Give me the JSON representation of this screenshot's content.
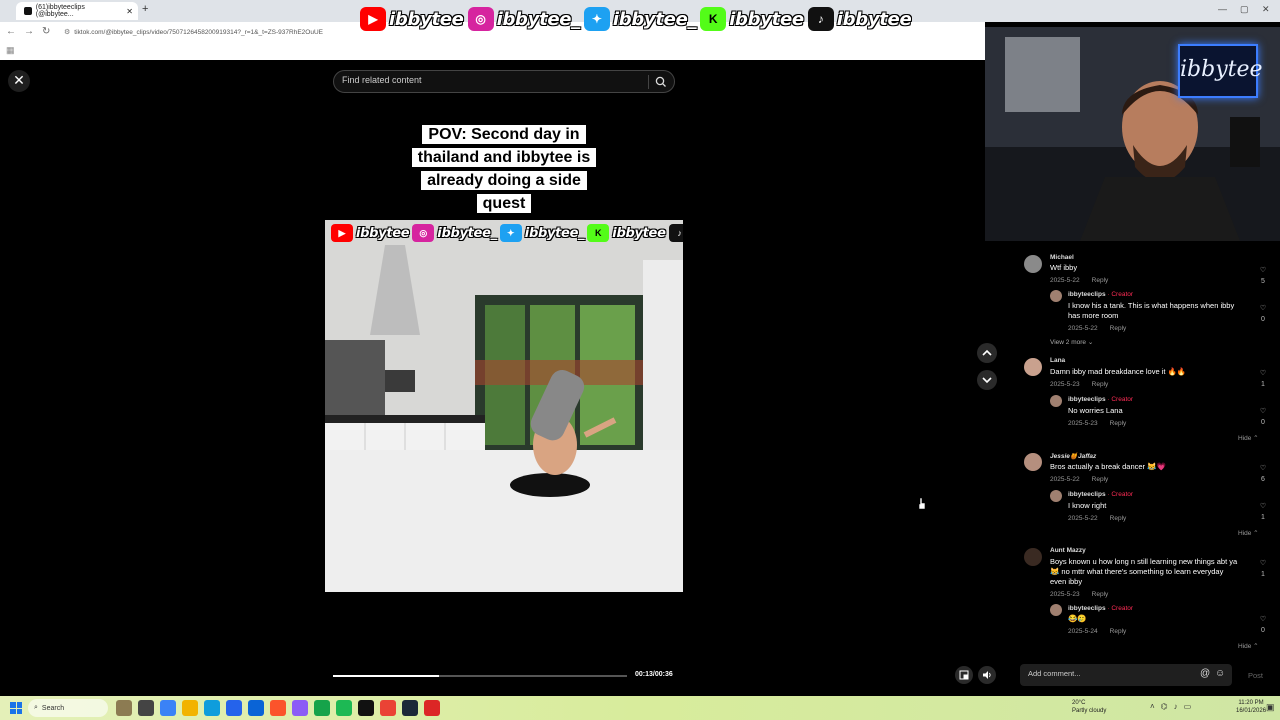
{
  "browser": {
    "tab_title": "(61)ibbyteeclips (@ibbytee...",
    "url": "tiktok.com/@ibbytee_clips/video/7507126458200919314?_r=1&_t=ZS-937RhE2OuUE"
  },
  "stream_banner": {
    "items": [
      {
        "platform": "youtube-icon",
        "handle": "ibbytee",
        "color": "#ff0000"
      },
      {
        "platform": "instagram-icon",
        "handle": "ibbytee_",
        "color": "#d6249f"
      },
      {
        "platform": "twitter-icon",
        "handle": "ibbytee_",
        "color": "#1da1f2"
      },
      {
        "platform": "kick-icon",
        "handle": "ibbytee",
        "color": "#53fc18"
      },
      {
        "platform": "tiktok-icon",
        "handle": "ibbytee",
        "color": "#111111"
      }
    ]
  },
  "search": {
    "placeholder": "Find related content"
  },
  "video": {
    "caption": "POV: Second day in thailand and ibbytee is already doing a side quest",
    "timecode": "00:13/00:36",
    "progress": 0.36
  },
  "webcam": {
    "sign_text": "ibbytee"
  },
  "comments": [
    {
      "user": "Michael",
      "text": "Wtf ibby",
      "date": "2025-5-22",
      "reply_label": "Reply",
      "likes": "5",
      "replies": [
        {
          "user": "ibbyteeclips",
          "creator_label": "· Creator",
          "text": "I know his a tank. This is what happens when ibby has more room",
          "date": "2025-5-22",
          "reply_label": "Reply",
          "likes": "0"
        }
      ],
      "view_more": "View 2 more"
    },
    {
      "user": "Lana",
      "text": "Damn ibby mad breakdance love it 🔥🔥",
      "date": "2025-5-23",
      "reply_label": "Reply",
      "likes": "1",
      "replies": [
        {
          "user": "ibbyteeclips",
          "creator_label": "· Creator",
          "text": "No worries Lana",
          "date": "2025-5-23",
          "reply_label": "Reply",
          "likes": "0"
        }
      ],
      "hide": "Hide"
    },
    {
      "user": "Jessie🍯Jaffaz",
      "text": "Bros actually a break dancer 😹💗",
      "date": "2025-5-22",
      "reply_label": "Reply",
      "likes": "6",
      "replies": [
        {
          "user": "ibbyteeclips",
          "creator_label": "· Creator",
          "text": "I know right",
          "date": "2025-5-22",
          "reply_label": "Reply",
          "likes": "1"
        }
      ],
      "hide": "Hide"
    },
    {
      "user": "Aunt Mazzy",
      "text": "Boys known u how long n still learning new things abt ya 😹 no mttr what there's something to learn everyday even ibby",
      "date": "2025-5-23",
      "reply_label": "Reply",
      "likes": "1",
      "replies": [
        {
          "user": "ibbyteeclips",
          "creator_label": "· Creator",
          "text": "😂🥲",
          "date": "2025-5-24",
          "reply_label": "Reply",
          "likes": "0"
        }
      ],
      "hide": "Hide"
    }
  ],
  "comment_input": {
    "placeholder": "Add comment...",
    "post_label": "Post"
  },
  "taskbar": {
    "search_label": "Search",
    "weather_temp": "20°C",
    "weather_desc": "Partly cloudy",
    "time": "11:20 PM",
    "date": "16/01/2026"
  }
}
